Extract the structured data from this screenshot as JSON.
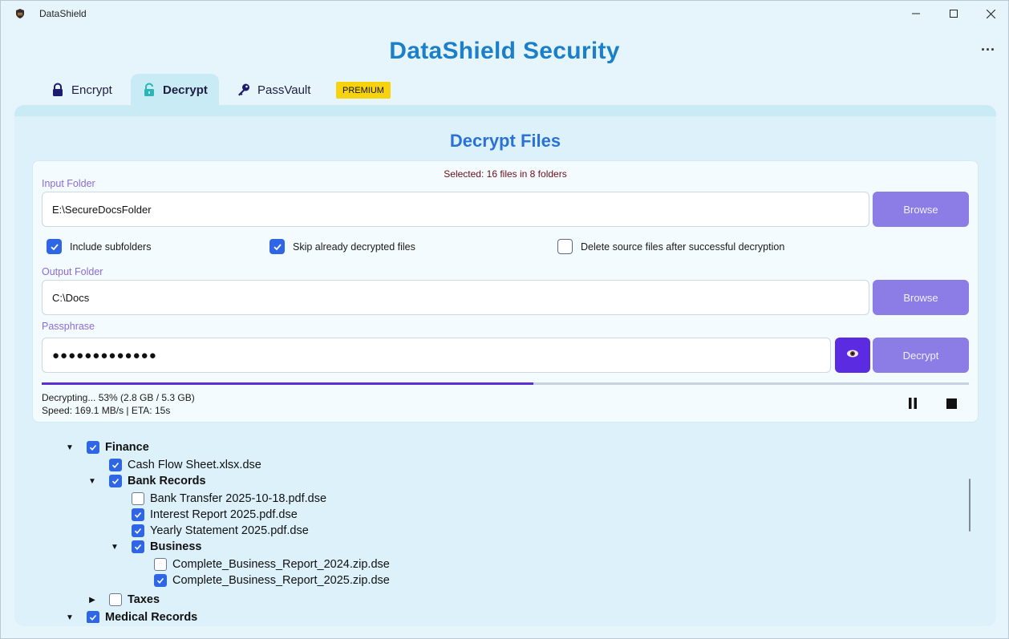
{
  "window": {
    "title": "DataShield",
    "minimize_icon": "minimize-icon",
    "maximize_icon": "maximize-icon",
    "close_icon": "close-icon",
    "more_label": "..."
  },
  "header": {
    "title": "DataShield Security"
  },
  "tabs": [
    {
      "label": "Encrypt",
      "icon": "lock-icon",
      "active": false
    },
    {
      "label": "Decrypt",
      "icon": "unlock-icon",
      "active": true
    },
    {
      "label": "PassVault",
      "icon": "key-icon",
      "active": false
    }
  ],
  "premium_badge": "PREMIUM",
  "decrypt": {
    "title": "Decrypt Files",
    "selected_info": "Selected: 16 files in 8 folders",
    "input_folder": {
      "label": "Input Folder",
      "value": "E:\\SecureDocsFolder",
      "browse_label": "Browse"
    },
    "options": [
      {
        "label": "Include subfolders",
        "checked": true
      },
      {
        "label": "Skip already decrypted files",
        "checked": true
      },
      {
        "label": "Delete source files after successful decryption",
        "checked": false
      }
    ],
    "output_folder": {
      "label": "Output Folder",
      "value": "C:\\Docs",
      "browse_label": "Browse"
    },
    "passphrase": {
      "label": "Passphrase",
      "value": "●●●●●●●●●●●●●",
      "toggle_icon": "eye-icon",
      "decrypt_label": "Decrypt"
    },
    "progress": {
      "percent": 53,
      "status_line": "Decrypting... 53% (2.8 GB / 5.3 GB)",
      "speed_line": "Speed: 169.1 MB/s | ETA: 15s",
      "pause_icon": "pause-icon",
      "stop_icon": "stop-icon"
    }
  },
  "tree": [
    {
      "label": "Finance",
      "folder": true,
      "expanded": true,
      "checked": true,
      "depth": 0
    },
    {
      "label": "Cash Flow Sheet.xlsx.dse",
      "folder": false,
      "checked": true,
      "depth": 1
    },
    {
      "label": "Bank Records",
      "folder": true,
      "expanded": true,
      "checked": true,
      "depth": 1
    },
    {
      "label": "Bank Transfer 2025-10-18.pdf.dse",
      "folder": false,
      "checked": false,
      "depth": 2
    },
    {
      "label": "Interest Report 2025.pdf.dse",
      "folder": false,
      "checked": true,
      "depth": 2
    },
    {
      "label": "Yearly Statement 2025.pdf.dse",
      "folder": false,
      "checked": true,
      "depth": 2
    },
    {
      "label": "Business",
      "folder": true,
      "expanded": true,
      "checked": true,
      "depth": 2
    },
    {
      "label": "Complete_Business_Report_2024.zip.dse",
      "folder": false,
      "checked": false,
      "depth": 3
    },
    {
      "label": "Complete_Business_Report_2025.zip.dse",
      "folder": false,
      "checked": true,
      "depth": 3
    },
    {
      "label": "Taxes",
      "folder": true,
      "expanded": false,
      "checked": false,
      "depth": 1
    },
    {
      "label": "Medical Records",
      "folder": true,
      "expanded": true,
      "checked": true,
      "depth": 0
    }
  ]
}
